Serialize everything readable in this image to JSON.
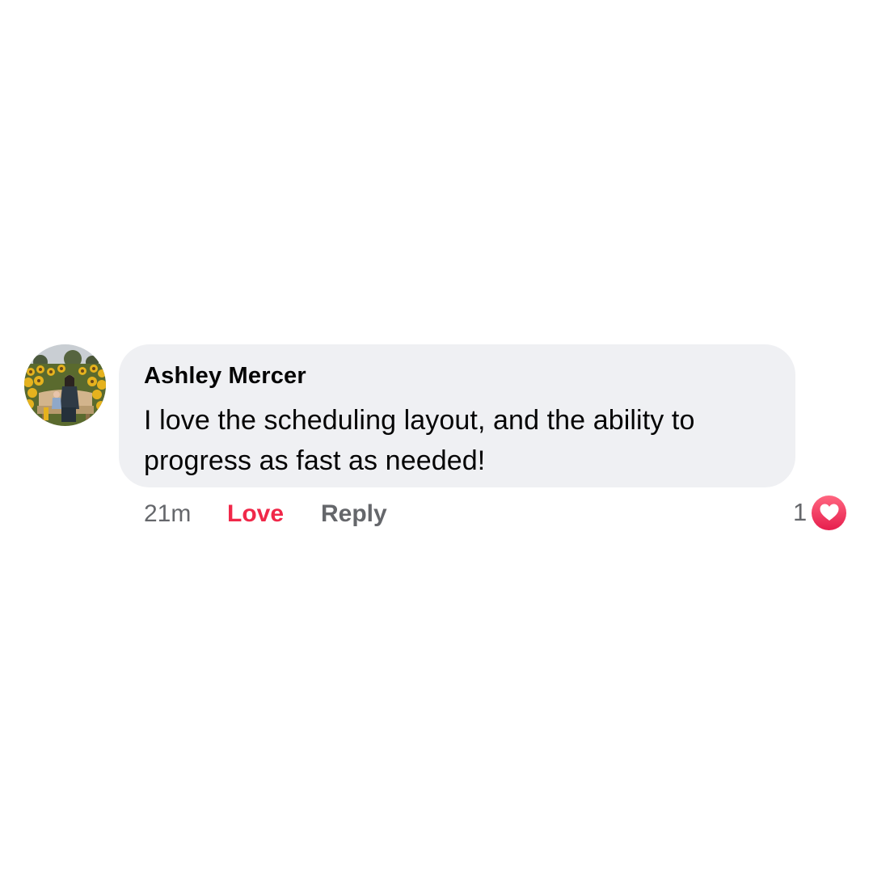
{
  "comment": {
    "author": "Ashley Mercer",
    "text": "I love the scheduling layout, and the ability to progress as fast as needed!",
    "timestamp": "21m",
    "actions": {
      "love_label": "Love",
      "reply_label": "Reply"
    },
    "reactions": {
      "count": "1",
      "type": "heart-icon"
    }
  },
  "colors": {
    "bubble_background": "#eff0f3",
    "love_active": "#f02849",
    "meta_gray": "#65676b",
    "text": "#050505"
  }
}
